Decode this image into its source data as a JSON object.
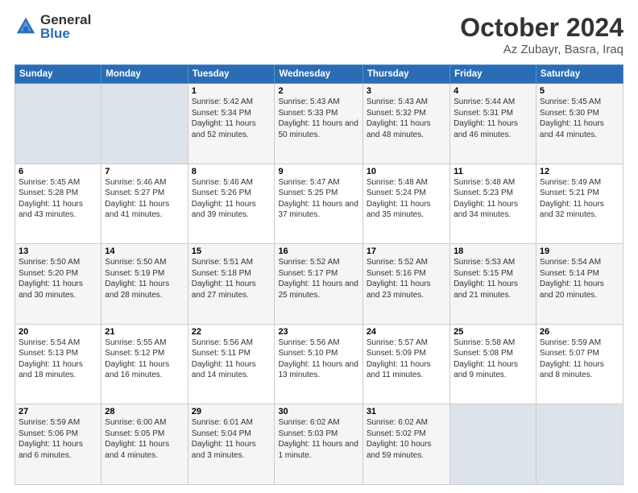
{
  "logo": {
    "general": "General",
    "blue": "Blue"
  },
  "title": "October 2024",
  "location": "Az Zubayr, Basra, Iraq",
  "headers": [
    "Sunday",
    "Monday",
    "Tuesday",
    "Wednesday",
    "Thursday",
    "Friday",
    "Saturday"
  ],
  "weeks": [
    [
      {
        "day": "",
        "info": "",
        "empty": true
      },
      {
        "day": "",
        "info": "",
        "empty": true
      },
      {
        "day": "1",
        "info": "Sunrise: 5:42 AM\nSunset: 5:34 PM\nDaylight: 11 hours and 52 minutes."
      },
      {
        "day": "2",
        "info": "Sunrise: 5:43 AM\nSunset: 5:33 PM\nDaylight: 11 hours and 50 minutes."
      },
      {
        "day": "3",
        "info": "Sunrise: 5:43 AM\nSunset: 5:32 PM\nDaylight: 11 hours and 48 minutes."
      },
      {
        "day": "4",
        "info": "Sunrise: 5:44 AM\nSunset: 5:31 PM\nDaylight: 11 hours and 46 minutes."
      },
      {
        "day": "5",
        "info": "Sunrise: 5:45 AM\nSunset: 5:30 PM\nDaylight: 11 hours and 44 minutes."
      }
    ],
    [
      {
        "day": "6",
        "info": "Sunrise: 5:45 AM\nSunset: 5:28 PM\nDaylight: 11 hours and 43 minutes."
      },
      {
        "day": "7",
        "info": "Sunrise: 5:46 AM\nSunset: 5:27 PM\nDaylight: 11 hours and 41 minutes."
      },
      {
        "day": "8",
        "info": "Sunrise: 5:46 AM\nSunset: 5:26 PM\nDaylight: 11 hours and 39 minutes."
      },
      {
        "day": "9",
        "info": "Sunrise: 5:47 AM\nSunset: 5:25 PM\nDaylight: 11 hours and 37 minutes."
      },
      {
        "day": "10",
        "info": "Sunrise: 5:48 AM\nSunset: 5:24 PM\nDaylight: 11 hours and 35 minutes."
      },
      {
        "day": "11",
        "info": "Sunrise: 5:48 AM\nSunset: 5:23 PM\nDaylight: 11 hours and 34 minutes."
      },
      {
        "day": "12",
        "info": "Sunrise: 5:49 AM\nSunset: 5:21 PM\nDaylight: 11 hours and 32 minutes."
      }
    ],
    [
      {
        "day": "13",
        "info": "Sunrise: 5:50 AM\nSunset: 5:20 PM\nDaylight: 11 hours and 30 minutes."
      },
      {
        "day": "14",
        "info": "Sunrise: 5:50 AM\nSunset: 5:19 PM\nDaylight: 11 hours and 28 minutes."
      },
      {
        "day": "15",
        "info": "Sunrise: 5:51 AM\nSunset: 5:18 PM\nDaylight: 11 hours and 27 minutes."
      },
      {
        "day": "16",
        "info": "Sunrise: 5:52 AM\nSunset: 5:17 PM\nDaylight: 11 hours and 25 minutes."
      },
      {
        "day": "17",
        "info": "Sunrise: 5:52 AM\nSunset: 5:16 PM\nDaylight: 11 hours and 23 minutes."
      },
      {
        "day": "18",
        "info": "Sunrise: 5:53 AM\nSunset: 5:15 PM\nDaylight: 11 hours and 21 minutes."
      },
      {
        "day": "19",
        "info": "Sunrise: 5:54 AM\nSunset: 5:14 PM\nDaylight: 11 hours and 20 minutes."
      }
    ],
    [
      {
        "day": "20",
        "info": "Sunrise: 5:54 AM\nSunset: 5:13 PM\nDaylight: 11 hours and 18 minutes."
      },
      {
        "day": "21",
        "info": "Sunrise: 5:55 AM\nSunset: 5:12 PM\nDaylight: 11 hours and 16 minutes."
      },
      {
        "day": "22",
        "info": "Sunrise: 5:56 AM\nSunset: 5:11 PM\nDaylight: 11 hours and 14 minutes."
      },
      {
        "day": "23",
        "info": "Sunrise: 5:56 AM\nSunset: 5:10 PM\nDaylight: 11 hours and 13 minutes."
      },
      {
        "day": "24",
        "info": "Sunrise: 5:57 AM\nSunset: 5:09 PM\nDaylight: 11 hours and 11 minutes."
      },
      {
        "day": "25",
        "info": "Sunrise: 5:58 AM\nSunset: 5:08 PM\nDaylight: 11 hours and 9 minutes."
      },
      {
        "day": "26",
        "info": "Sunrise: 5:59 AM\nSunset: 5:07 PM\nDaylight: 11 hours and 8 minutes."
      }
    ],
    [
      {
        "day": "27",
        "info": "Sunrise: 5:59 AM\nSunset: 5:06 PM\nDaylight: 11 hours and 6 minutes."
      },
      {
        "day": "28",
        "info": "Sunrise: 6:00 AM\nSunset: 5:05 PM\nDaylight: 11 hours and 4 minutes."
      },
      {
        "day": "29",
        "info": "Sunrise: 6:01 AM\nSunset: 5:04 PM\nDaylight: 11 hours and 3 minutes."
      },
      {
        "day": "30",
        "info": "Sunrise: 6:02 AM\nSunset: 5:03 PM\nDaylight: 11 hours and 1 minute."
      },
      {
        "day": "31",
        "info": "Sunrise: 6:02 AM\nSunset: 5:02 PM\nDaylight: 10 hours and 59 minutes."
      },
      {
        "day": "",
        "info": "",
        "empty": true
      },
      {
        "day": "",
        "info": "",
        "empty": true
      }
    ]
  ]
}
